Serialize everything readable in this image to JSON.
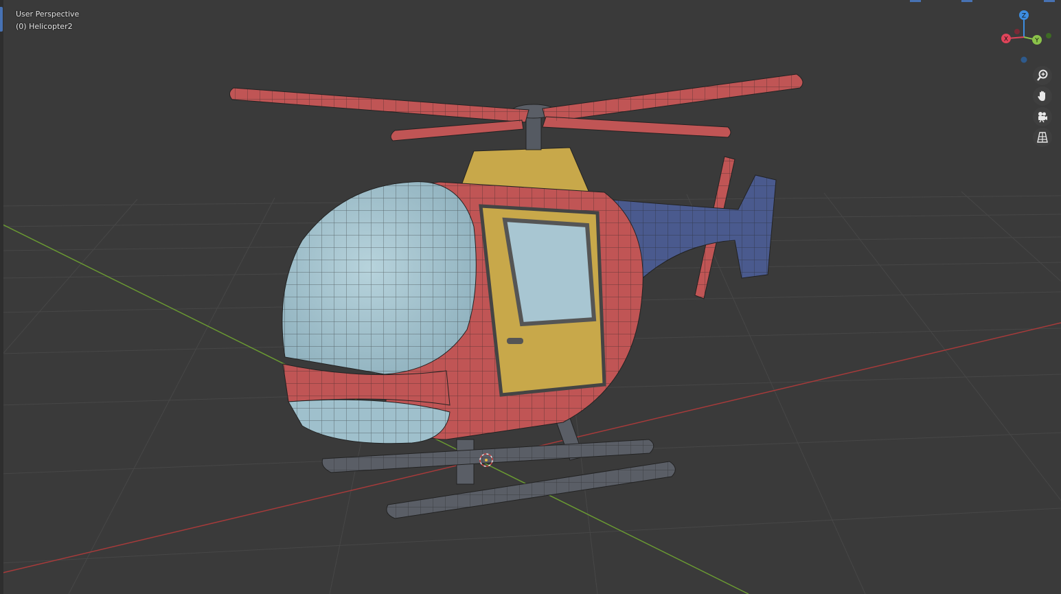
{
  "viewport": {
    "view_name": "User Perspective",
    "object_name": "(0) Helicopter2"
  },
  "gizmo": {
    "x_label": "X",
    "y_label": "Y",
    "z_label": "Z",
    "colors": {
      "x": "#e0445a",
      "y": "#8bc34a",
      "z": "#3d8de0"
    }
  },
  "nav_buttons": [
    {
      "icon": "zoom-icon"
    },
    {
      "icon": "hand-pan-icon"
    },
    {
      "icon": "camera-icon"
    },
    {
      "icon": "grid-perspective-icon"
    }
  ],
  "colors": {
    "background": "#3a3a3a",
    "grid": "#464646",
    "x_axis": "#a83a3a",
    "y_axis": "#6a9a32",
    "canopy": "#9fc0cc",
    "body_red": "#c05555",
    "yellow": "#c8a84a",
    "tail_blue": "#4a5a8e",
    "skid_gray": "#5a5e66"
  }
}
